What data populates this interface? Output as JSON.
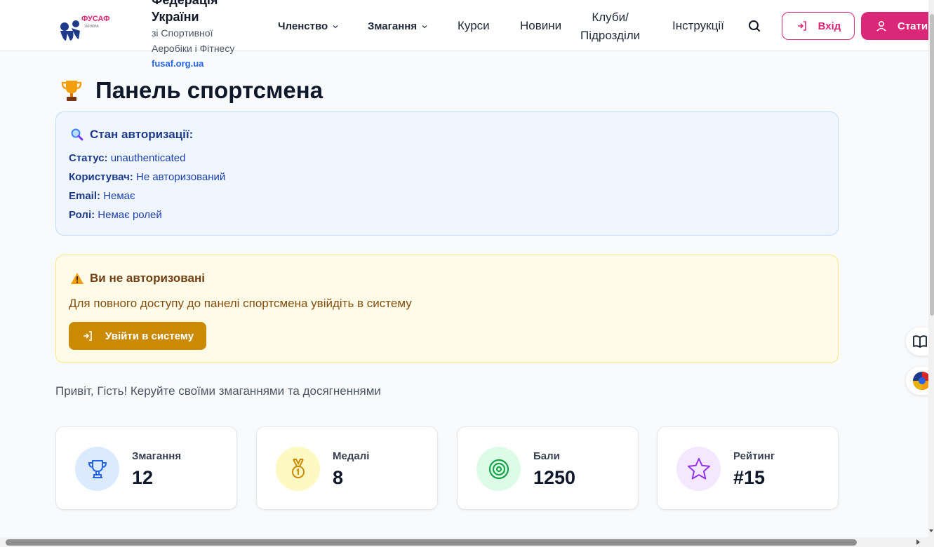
{
  "header": {
    "org_cut_line": "Федерація",
    "org_title": "України",
    "org_sub1": "зі Спортивної",
    "org_sub2": "Аеробіки і Фітнесу",
    "org_link": "fusaf.org.ua",
    "logo_text": "ФУСАФ",
    "logo_subtext": "УКРАЇНА",
    "nav": {
      "membership": "Членство",
      "competitions": "Змагання",
      "courses": "Курси",
      "news": "Новини",
      "clubs_line1": "Клуби/",
      "clubs_line2": "Підрозділи",
      "instructions": "Інструкції"
    },
    "login_label": "Вхід",
    "register_label": "Стати",
    "brand_color": "#db2777"
  },
  "main": {
    "page_title": "Панель спортсмена",
    "auth": {
      "heading": "Стан авторизації:",
      "rows": [
        {
          "key": "Статус:",
          "value": "unauthenticated"
        },
        {
          "key": "Користувач:",
          "value": "Не авторизований"
        },
        {
          "key": "Email:",
          "value": "Немає"
        },
        {
          "key": "Ролі:",
          "value": "Немає ролей"
        }
      ]
    },
    "warning": {
      "heading": "Ви не авторизовані",
      "text": "Для повного доступу до панелі спортсмена увійдіть в систему",
      "button": "Увійти в систему"
    },
    "greeting": "Привіт, Гість! Керуйте своїми змаганнями та досягненнями",
    "stats": [
      {
        "label": "Змагання",
        "value": "12",
        "icon": "trophy-icon",
        "color": "#2563eb",
        "bg": "#dbeafe"
      },
      {
        "label": "Медалі",
        "value": "8",
        "icon": "medal-icon",
        "color": "#ca8a04",
        "bg": "#fef9c3"
      },
      {
        "label": "Бали",
        "value": "1250",
        "icon": "target-icon",
        "color": "#16a34a",
        "bg": "#dcfce7"
      },
      {
        "label": "Рейтинг",
        "value": "#15",
        "icon": "star-icon",
        "color": "#9333ea",
        "bg": "#f3e8ff"
      }
    ]
  }
}
